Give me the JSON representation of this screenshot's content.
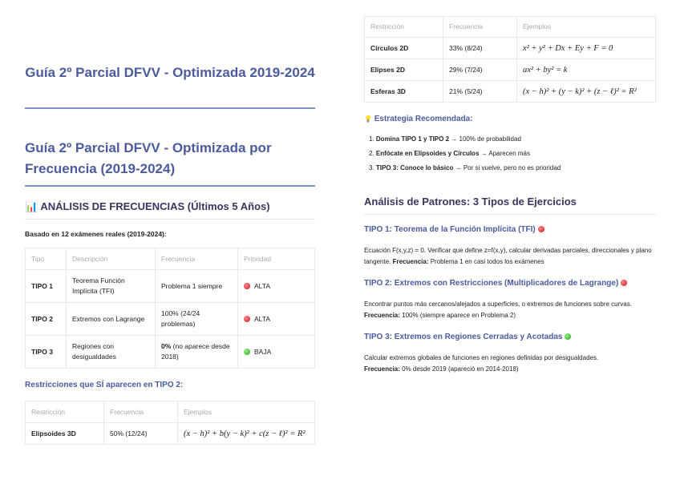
{
  "cover": {
    "title": "Guía 2º Parcial DFVV - Optimizada 2019-2024"
  },
  "heading": "Guía 2º Parcial DFVV - Optimizada por Frecuencia (2019-2024)",
  "analysis": {
    "icon": "📊",
    "title": "ANÁLISIS DE FRECUENCIAS (Últimos 5 Años)",
    "basis": "Basado en 12 exámenes reales (2019-2024):"
  },
  "types_table": {
    "headers": [
      "Tipo",
      "Descripción",
      "Frecuencia",
      "Prioridad"
    ],
    "rows": [
      {
        "tipo": "TIPO 1",
        "desc": "Teorema Función Implícita (TFI)",
        "freq_bold": "",
        "freq": "Problema 1 siempre",
        "prio": "ALTA",
        "color": "red"
      },
      {
        "tipo": "TIPO 2",
        "desc": "Extremos con Lagrange",
        "freq_bold": "",
        "freq": "100% (24/24 problemas)",
        "prio": "ALTA",
        "color": "red"
      },
      {
        "tipo": "TIPO 3",
        "desc": "Regiones con desigualdades",
        "freq_bold": "0%",
        "freq": " (no aparece desde 2018)",
        "prio": "BAJA",
        "color": "green"
      }
    ]
  },
  "restr_title": "Restricciones que SÍ aparecen en TIPO 2:",
  "restr_table": {
    "headers": [
      "Restricción",
      "Frecuencia",
      "Ejemplos"
    ],
    "rows": [
      {
        "name": "Elipsoides 3D",
        "freq": "50% (12/24)",
        "example": "(x − h)² + b(y − k)² + c(z − ℓ)² = R²"
      },
      {
        "name": "Círculos 2D",
        "freq": "33% (8/24)",
        "example": "x² + y² + Dx + Ey + F = 0"
      },
      {
        "name": "Elipses 2D",
        "freq": "29% (7/24)",
        "example": "ax² + by² = k"
      },
      {
        "name": "Esferas 3D",
        "freq": "21% (5/24)",
        "example": "(x − h)² + (y − k)² + (z − ℓ)² = R²"
      }
    ]
  },
  "strategy": {
    "icon": "💡",
    "title": "Estrategia Recomendada:",
    "items": [
      {
        "n": "1.",
        "bold": "Domina TIPO 1 y TIPO 2",
        "rest": " → 100% de probabilidad"
      },
      {
        "n": "2.",
        "bold": "Enfócate en Elipsoides y Círculos",
        "rest": " → Aparecen más"
      },
      {
        "n": "3.",
        "bold": "TIPO 3: Conoce lo básico",
        "rest": " → Por si vuelve, pero no es prioridad"
      }
    ]
  },
  "patterns": {
    "title": "Análisis de Patrones: 3 Tipos de Ejercicios",
    "types": [
      {
        "title": "TIPO 1: Teorema de la Función Implícita (TFI)",
        "color": "red",
        "text": "Ecuación F(x,y,z) = 0. Verificar que define z=f(x,y), calcular derivadas parciales, direccionales y plano tangente. ",
        "freq_label": "Frecuencia:",
        "freq": " Problema 1 en casi todos los exámenes"
      },
      {
        "title": "TIPO 2: Extremos con Restricciones (Multiplicadores de Lagrange)",
        "color": "red",
        "text": "Encontrar puntos más cercanos/alejados a superficies, o extremos de funciones sobre curvas. ",
        "freq_label": "Frecuencia:",
        "freq": " 100% (siempre aparece en Problema 2)"
      },
      {
        "title": "TIPO 3: Extremos en Regiones Cerradas y Acotadas",
        "color": "green",
        "text": "Calcular extremos globales de funciones en regiones definidas por desigualdades. ",
        "freq_label": "Frecuencia:",
        "freq": " 0% desde 2019 (apareció en 2014-2018)"
      }
    ]
  }
}
